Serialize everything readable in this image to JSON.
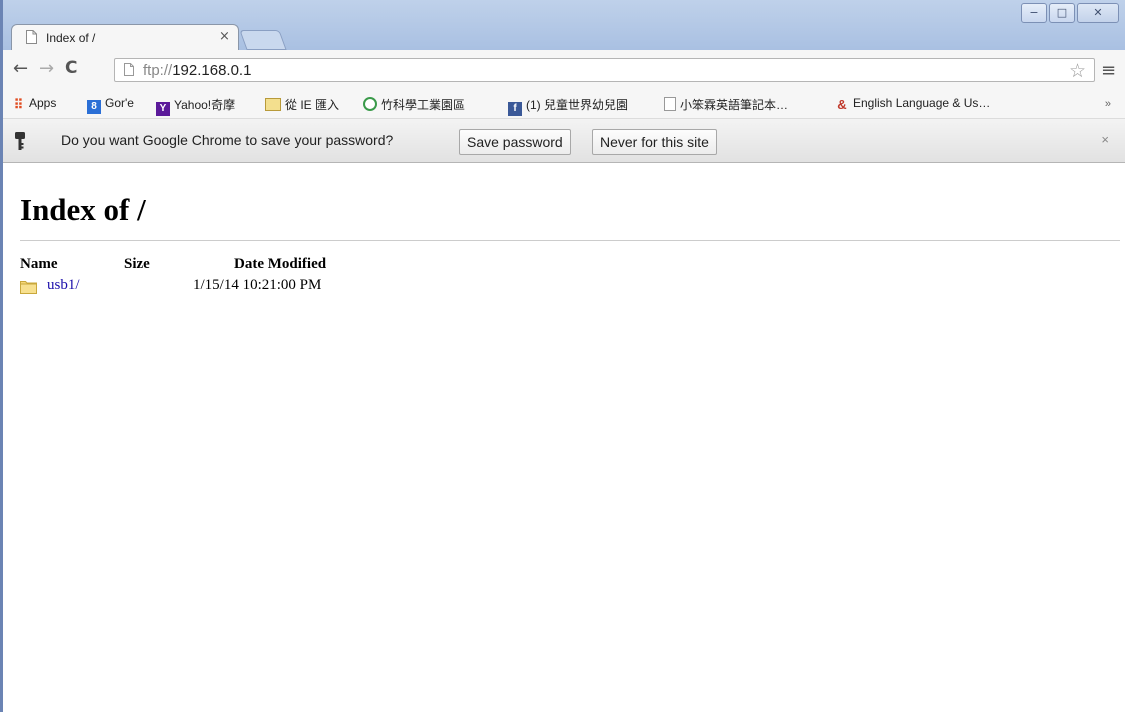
{
  "tab": {
    "title": "Index of /",
    "close": "×"
  },
  "window_controls": {
    "minimize": "−",
    "maximize": "□",
    "close": "✕"
  },
  "toolbar": {
    "back": "←",
    "forward": "→",
    "reload": "C",
    "url_scheme": "ftp://",
    "url_host": "192.168.0.1",
    "star": "☆",
    "menu": "≡"
  },
  "bookmarks": {
    "items": [
      {
        "label": "Apps",
        "icon": "apps-grid-icon"
      },
      {
        "label": "Gor'e",
        "icon": "google-icon"
      },
      {
        "label": "Yahoo!奇摩",
        "icon": "yahoo-icon"
      },
      {
        "label": "從 IE 匯入",
        "icon": "folder-icon"
      },
      {
        "label": "竹科學工業園區",
        "icon": "sipa-icon"
      },
      {
        "label": "(1) 兒童世界幼兒園",
        "icon": "facebook-icon"
      },
      {
        "label": "小笨霖英語筆記本…",
        "icon": "page-icon"
      },
      {
        "label": "English Language & Us…",
        "icon": "stack-exchange-icon"
      }
    ],
    "more": "»"
  },
  "infobar": {
    "text": "Do you want Google Chrome to save your password?",
    "save_label": "Save password",
    "never_label": "Never for this site",
    "close": "×"
  },
  "page": {
    "title": "Index of /",
    "columns": [
      "Name",
      "Size",
      "Date Modified"
    ],
    "rows": [
      {
        "name": "usb1/",
        "size": "",
        "date": "1/15/14 10:21:00 PM"
      }
    ]
  }
}
